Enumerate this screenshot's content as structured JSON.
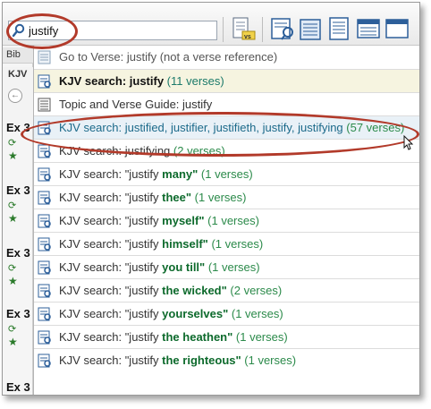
{
  "search": {
    "value": "justify"
  },
  "left": {
    "tab": "Bib",
    "kjv": "KJV",
    "entries": [
      "Ex 3",
      "Ex 3",
      "Ex 3",
      "Ex 3",
      "Ex 3"
    ]
  },
  "dropdown": {
    "items": [
      {
        "prefix": "Go to Verse: justify (not a verse reference)"
      },
      {
        "prefix": "KJV search: justify",
        "suffix": " (11 verses)"
      },
      {
        "prefix": "Topic and Verse Guide: justify"
      },
      {
        "prefix": "KJV search: justified, justifier, justifieth, justify, justifying",
        "suffix": " (57 verses)"
      },
      {
        "prefix": "KJV search: justifying",
        "suffix": " (2 verses)"
      },
      {
        "prefix": "KJV search: \"justify ",
        "bold": "many",
        "mid": "\"",
        "suffix": " (1 verses)"
      },
      {
        "prefix": "KJV search: \"justify ",
        "bold": "thee",
        "mid": "\"",
        "suffix": " (1 verses)"
      },
      {
        "prefix": "KJV search: \"justify ",
        "bold": "myself",
        "mid": "\"",
        "suffix": " (1 verses)"
      },
      {
        "prefix": "KJV search: \"justify ",
        "bold": "himself",
        "mid": "\"",
        "suffix": " (1 verses)"
      },
      {
        "prefix": "KJV search: \"justify ",
        "bold": "you till",
        "mid": "\"",
        "suffix": " (1 verses)"
      },
      {
        "prefix": "KJV search: \"justify ",
        "bold": "the wicked",
        "mid": "\"",
        "suffix": " (2 verses)"
      },
      {
        "prefix": "KJV search: \"justify ",
        "bold": "yourselves",
        "mid": "\"",
        "suffix": " (1 verses)"
      },
      {
        "prefix": "KJV search: \"justify ",
        "bold": "the heathen",
        "mid": "\"",
        "suffix": " (1 verses)"
      },
      {
        "prefix": "KJV search: \"justify ",
        "bold": "the righteous",
        "mid": "\"",
        "suffix": " (1 verses)"
      }
    ]
  },
  "colors": {
    "annotation": "#b23a2a",
    "selected": "#e9f1f7",
    "highlight": "#f6f4e0",
    "green": "#0d6a2c"
  }
}
